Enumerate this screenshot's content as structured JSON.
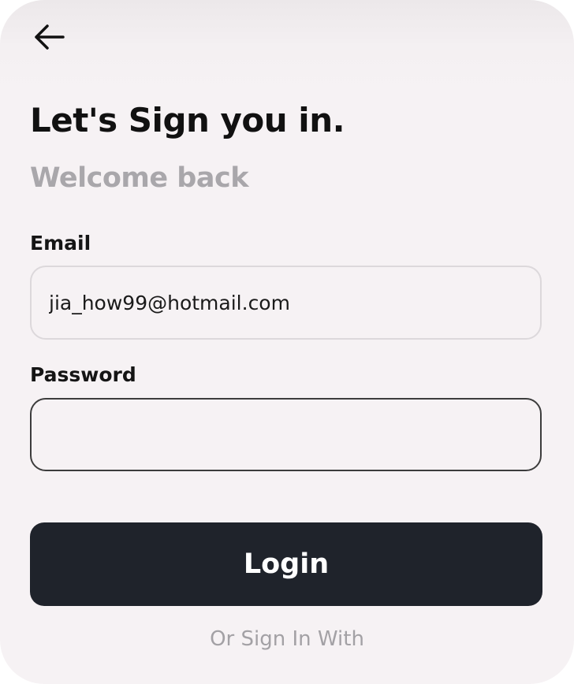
{
  "header": {
    "back_icon": "arrow-left-icon"
  },
  "title": "Let's Sign you in.",
  "subtitle": "Welcome back",
  "form": {
    "email_label": "Email",
    "email_value": "jia_how99@hotmail.com",
    "password_label": "Password",
    "password_value": ""
  },
  "login_button": "Login",
  "alt_signin_text": "Or Sign In With",
  "colors": {
    "background": "#f6f2f4",
    "button": "#1f232b",
    "subtitle": "#a9a7ab"
  }
}
